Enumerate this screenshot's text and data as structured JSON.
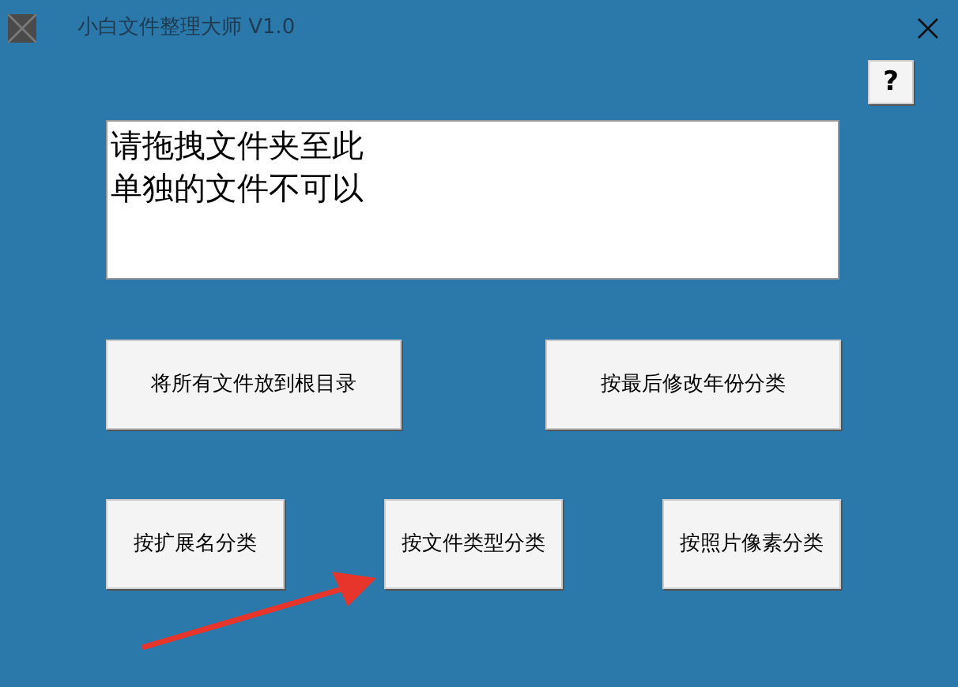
{
  "window": {
    "title": "小白文件整理大师 V1.0"
  },
  "help_button": {
    "label": "?"
  },
  "drop_area": {
    "lines": [
      "请拖拽文件夹至此",
      "单独的文件不可以"
    ]
  },
  "button_rows": [
    [
      "将所有文件放到根目录",
      "按最后修改年份分类"
    ],
    [
      "按扩展名分类",
      "按文件类型分类",
      "按照片像素分类"
    ]
  ]
}
